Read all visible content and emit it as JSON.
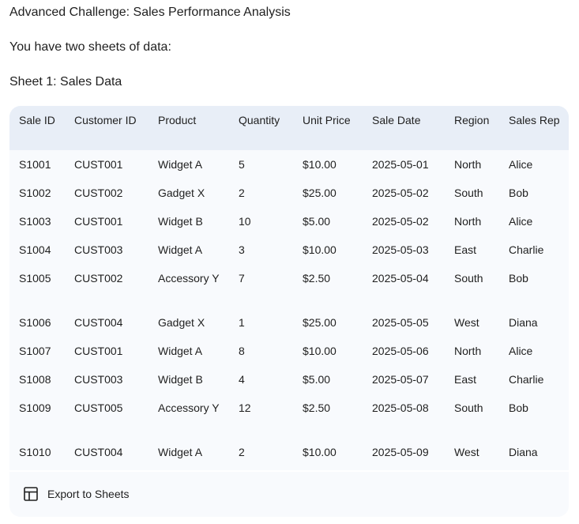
{
  "title": "Advanced Challenge: Sales Performance Analysis",
  "intro": "You have two sheets of data:",
  "sheet_title": "Sheet 1: Sales Data",
  "table": {
    "headers": [
      "Sale ID",
      "Customer ID",
      "Product",
      "Quantity",
      "Unit Price",
      "Sale Date",
      "Region",
      "Sales Rep"
    ],
    "rows": [
      [
        "S1001",
        "CUST001",
        "Widget A",
        "5",
        "$10.00",
        "2025-05-01",
        "North",
        "Alice"
      ],
      [
        "S1002",
        "CUST002",
        "Gadget X",
        "2",
        "$25.00",
        "2025-05-02",
        "South",
        "Bob"
      ],
      [
        "S1003",
        "CUST001",
        "Widget B",
        "10",
        "$5.00",
        "2025-05-02",
        "North",
        "Alice"
      ],
      [
        "S1004",
        "CUST003",
        "Widget A",
        "3",
        "$10.00",
        "2025-05-03",
        "East",
        "Charlie"
      ],
      [
        "S1005",
        "CUST002",
        "Accessory Y",
        "7",
        "$2.50",
        "2025-05-04",
        "South",
        "Bob"
      ],
      [
        "S1006",
        "CUST004",
        "Gadget X",
        "1",
        "$25.00",
        "2025-05-05",
        "West",
        "Diana"
      ],
      [
        "S1007",
        "CUST001",
        "Widget A",
        "8",
        "$10.00",
        "2025-05-06",
        "North",
        "Alice"
      ],
      [
        "S1008",
        "CUST003",
        "Widget B",
        "4",
        "$5.00",
        "2025-05-07",
        "East",
        "Charlie"
      ],
      [
        "S1009",
        "CUST005",
        "Accessory Y",
        "12",
        "$2.50",
        "2025-05-08",
        "South",
        "Bob"
      ],
      [
        "S1010",
        "CUST004",
        "Widget A",
        "2",
        "$10.00",
        "2025-05-09",
        "West",
        "Diana"
      ]
    ]
  },
  "export": {
    "label": "Export to Sheets",
    "icon": "table-icon"
  }
}
